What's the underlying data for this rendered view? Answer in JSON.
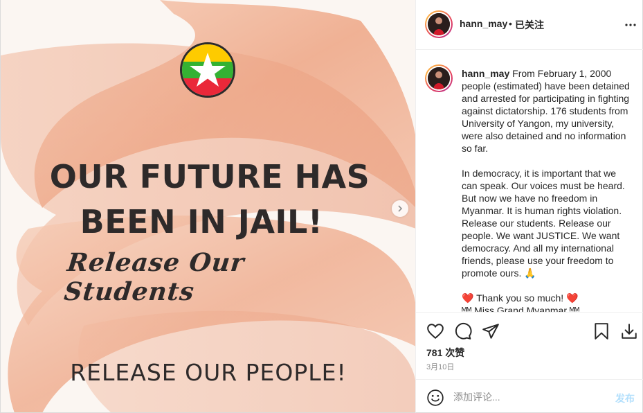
{
  "media": {
    "headline_line1": "OUR FUTURE HAS",
    "headline_line2": "BEEN IN JAIL!",
    "script_line": "Release Our Students",
    "bottom_line": "RELEASE OUR PEOPLE!",
    "flag_colors": {
      "top": "#FECB00",
      "middle": "#34B233",
      "bottom": "#EA2839",
      "star": "#FFFFFF"
    }
  },
  "header": {
    "username": "hann_may",
    "separator": "•",
    "follow_status": "已关注",
    "more_icon": "more-horizontal-icon"
  },
  "caption": {
    "username": "hann_may",
    "paragraph1": "From February 1, 2000 people (estimated) have been detained and arrested for participating in fighting against dictatorship. 176 students from University of Yangon, my university, were also detained and no information so far.",
    "paragraph2": "In democracy, it is important that we can speak. Our voices must be heard. But now we have no freedom in Myanmar. It is human rights violation. Release our students. Release our people. We want JUSTICE. We want democracy. And all my international friends, please use your freedom to promote ours.",
    "paragraph2_emoji": "🙏",
    "thanks_emoji": "❤️",
    "thanks_text": "Thank you so much!",
    "signoff": "ᴹᴹ Miss Grand Myanmar ᴹᴹ"
  },
  "actions": {
    "like_icon": "heart-icon",
    "comment_icon": "comment-icon",
    "share_icon": "share-icon",
    "save_icon": "bookmark-icon",
    "download_icon": "download-icon"
  },
  "likes_text": "781 次赞",
  "date_text": "3月10日",
  "comment_box": {
    "placeholder": "添加评论...",
    "post_label": "发布",
    "emoji_icon": "emoji-icon"
  },
  "colors": {
    "accent_disabled": "#B2DFFC",
    "text_primary": "#262626",
    "text_secondary": "#8E8E8E",
    "brush_stroke": "#EDA588"
  }
}
